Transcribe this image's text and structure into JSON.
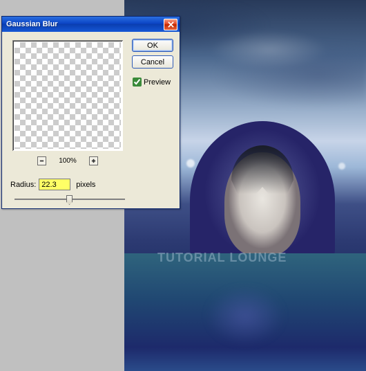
{
  "canvas": {
    "watermark": "TUTORIAL LOUNGE"
  },
  "dialog": {
    "title": "Gaussian Blur",
    "buttons": {
      "ok": "OK",
      "cancel": "Cancel"
    },
    "preview_label": "Preview",
    "preview_checked": true,
    "zoom": {
      "minus_icon": "minus-icon",
      "plus_icon": "plus-icon",
      "percent": "100%"
    },
    "radius": {
      "label": "Radius:",
      "value": "22.3",
      "units": "pixels"
    },
    "close_icon": "close-icon"
  }
}
